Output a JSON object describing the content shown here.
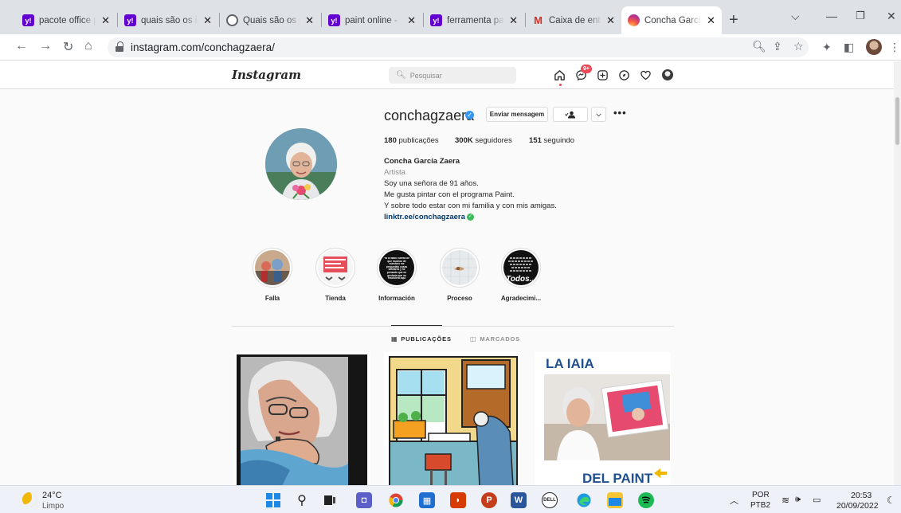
{
  "browser": {
    "tabs": [
      {
        "title": "pacote office p",
        "favicon": "yahoo-icon",
        "active": false
      },
      {
        "title": "quais são os ite",
        "favicon": "yahoo-icon",
        "active": false
      },
      {
        "title": "Quais são os p",
        "favicon": "globe-icon",
        "active": false
      },
      {
        "title": "paint online - ",
        "favicon": "yahoo-icon",
        "active": false
      },
      {
        "title": "ferramenta pai",
        "favicon": "yahoo-icon",
        "active": false
      },
      {
        "title": "Caixa de entra",
        "favicon": "gmail-icon",
        "active": false
      },
      {
        "title": "Concha Garcia",
        "favicon": "instagram-icon",
        "active": true
      }
    ],
    "url": "instagram.com/conchagzaera/"
  },
  "instagram": {
    "logo": "Instagram",
    "search_placeholder": "Pesquisar",
    "notification_count": "9+",
    "profile": {
      "username": "conchagzaera",
      "message_button": "Enviar mensagem",
      "stats": {
        "posts_num": "180",
        "posts_label": "publicações",
        "followers_num": "300K",
        "followers_label": "seguidores",
        "following_num": "151",
        "following_label": "seguindo"
      },
      "name": "Concha García Zaera",
      "category": "Artista",
      "bio": [
        "Soy una señora de 91 años.",
        "Me gusta pintar con el programa Paint.",
        "Y sobre todo estar con mi familia y con mis amigas."
      ],
      "link": "linktr.ee/conchagzaera"
    },
    "highlights": [
      "Falla",
      "Tienda",
      "Información",
      "Proceso",
      "Agradecimi..."
    ],
    "highlight_texts": {
      "informacion": "Ya lo dado cuenta de que muchos de nuestros me preguntáis cosas similares y he pensado que os gustaría que os resolviera aquí",
      "agradecimi": "Todos..."
    },
    "post_tabs": {
      "posts": "PUBLICAÇÕES",
      "tagged": "MARCADOS"
    },
    "post3": {
      "top": "LA IAIA",
      "bottom": "DEL PAINT"
    }
  },
  "taskbar": {
    "temp": "24°C",
    "weather": "Limpo",
    "lang": "POR",
    "layout": "PTB2",
    "time": "20:53",
    "date": "20/09/2022"
  },
  "colors": {
    "instagram_blue": "#3897f0",
    "link_blue": "#00376b",
    "notification_red": "#ed4956"
  }
}
